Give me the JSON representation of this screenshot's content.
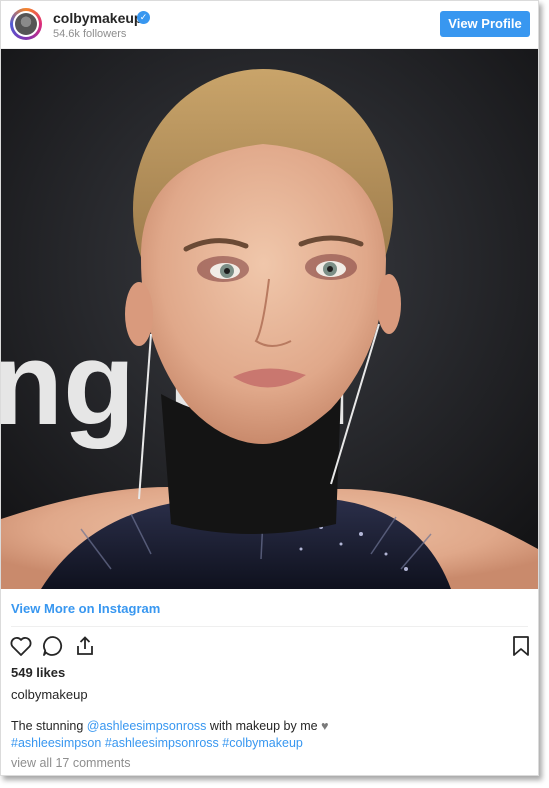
{
  "header": {
    "username": "colbymakeup",
    "verified_glyph": "✓",
    "followers": "54.6k followers",
    "view_profile_label": "View Profile"
  },
  "photo": {
    "sign_text": "ng Bal"
  },
  "footer": {
    "view_more_label": "View More on Instagram"
  },
  "actions": {
    "like_icon": "heart-icon",
    "comment_icon": "comment-icon",
    "share_icon": "share-icon",
    "save_icon": "bookmark-icon"
  },
  "post": {
    "likes": "549 likes",
    "owner": "colbymakeup",
    "caption_prefix": "The stunning ",
    "caption_mention": "@ashleesimpsonross",
    "caption_suffix": " with makeup by me ",
    "caption_heart": "♥",
    "hashtags": [
      "#ashleesimpson",
      "#ashleesimpsonross",
      "#colbymakeup"
    ],
    "comments_link": "view all 17 comments"
  },
  "colors": {
    "accent": "#3897f0",
    "text": "#262626",
    "muted": "#8e8e8e"
  }
}
